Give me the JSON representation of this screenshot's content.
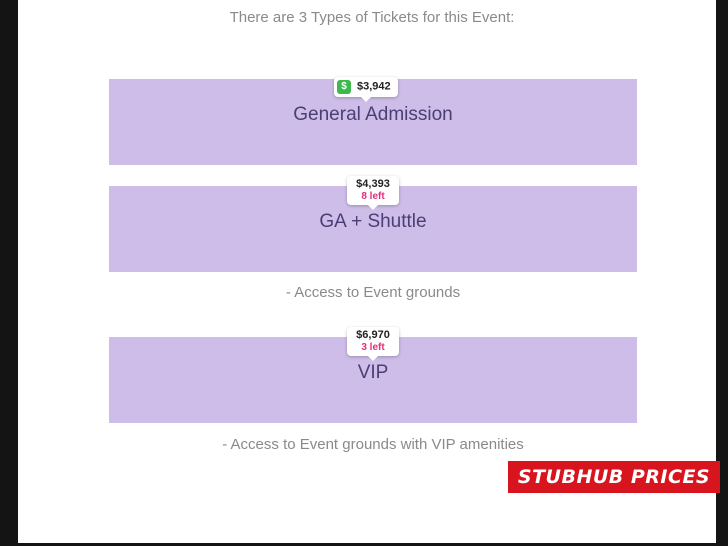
{
  "heading": "There are 3 Types of Tickets for this Event:",
  "tickets": [
    {
      "name": "General Admission",
      "price": "$3,942",
      "left": "",
      "deal_icon": "dollar-down-arrow-icon",
      "description": ""
    },
    {
      "name": "GA + Shuttle",
      "price": "$4,393",
      "left": "8 left",
      "description": "- Access to Event grounds"
    },
    {
      "name": "VIP",
      "price": "$6,970",
      "left": "3 left",
      "description": "- Access to Event grounds with VIP amenities"
    }
  ],
  "badge": "STUBHUB PRICES",
  "colors": {
    "ticket_bg": "#cdbde8",
    "ticket_text": "#4a3e74",
    "left_text": "#e0317a",
    "deal_icon": "#3db84d",
    "badge_bg": "#d8141e",
    "frame": "#141414"
  }
}
